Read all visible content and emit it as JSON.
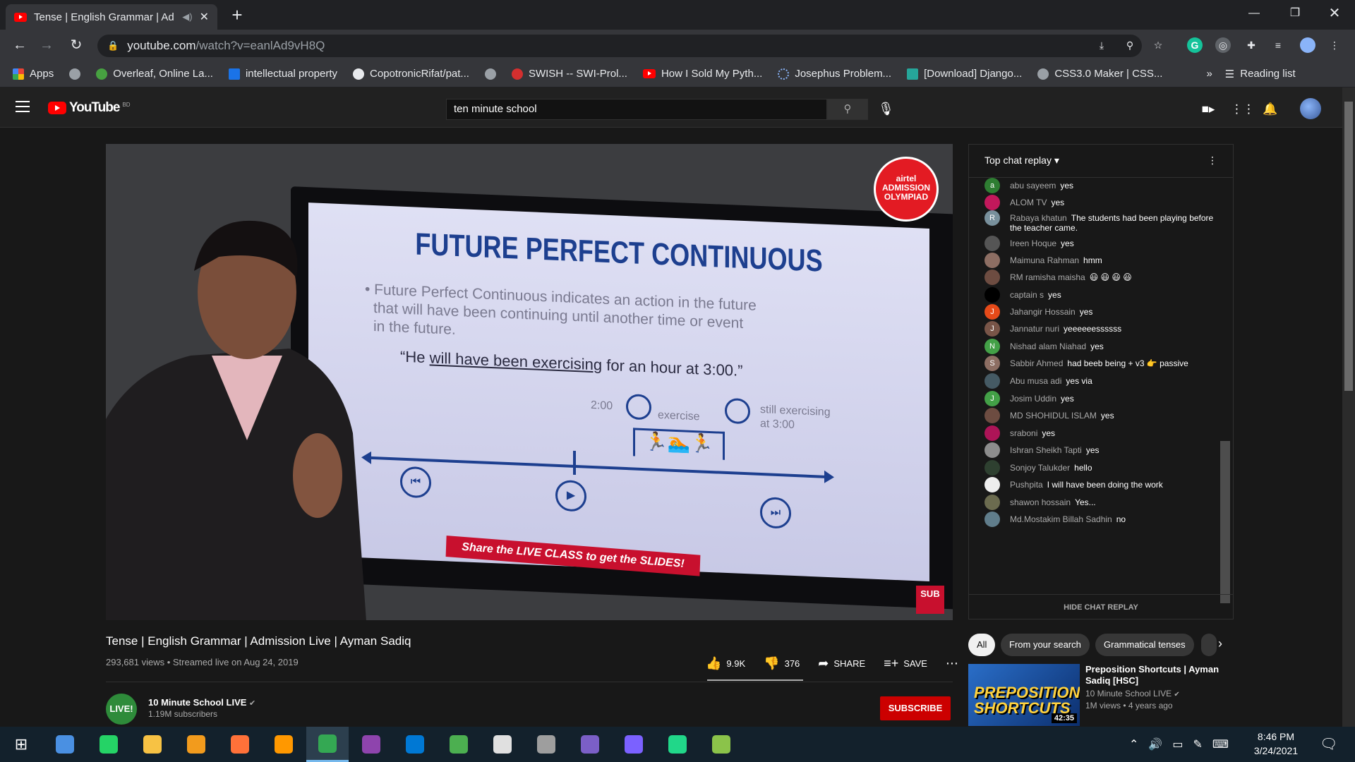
{
  "browser": {
    "tab_title": "Tense | English Grammar | Ad",
    "new_tab": "+",
    "url_host": "youtube.com",
    "url_path": "/watch?v=eanlAd9vH8Q",
    "bookmarks": [
      "Apps",
      "",
      "Overleaf, Online La...",
      "intellectual property",
      "CopotronicRifat/pat...",
      "",
      "SWISH -- SWI-Prol...",
      "How I Sold My Pyth...",
      "Josephus Problem...",
      "[Download] Django...",
      "CSS3.0 Maker | CSS..."
    ],
    "bookmarks_more": "»",
    "reading_list": "Reading list"
  },
  "youtube": {
    "logo_text": "YouTube",
    "country": "BD",
    "search_value": "ten minute school"
  },
  "video": {
    "slide_title": "FUTURE PERFECT CONTINUOUS",
    "slide_line1": "• Future Perfect Continuous indicates an action in the future",
    "slide_line2": "that will have been continuing until another time or event",
    "slide_line3": "in the future.",
    "slide_example_pre": "“He ",
    "slide_example_u": "will have been exercising",
    "slide_example_post": " for an hour at 3:00.”",
    "tl_time": "2:00",
    "tl_exercise": "exercise",
    "tl_still": "still exercising",
    "tl_still2": "at 3:00",
    "share_banner": "Share the LIVE CLASS to get the SLIDES!",
    "olympiad_brand": "airtel",
    "olympiad_line1": "ADMISSION",
    "olympiad_line2": "OLYMPIAD",
    "sub_mark": "SUB"
  },
  "info": {
    "title": "Tense | English Grammar | Admission Live | Ayman Sadiq",
    "meta": "293,681 views • Streamed live on Aug 24, 2019",
    "likes": "9.9K",
    "dislikes": "376",
    "share": "SHARE",
    "save": "SAVE",
    "channel": "10 Minute School LIVE",
    "subs": "1.19M subscribers",
    "subscribe": "SUBSCRIBE",
    "chan_avatar_text": "LIVE!"
  },
  "chat": {
    "header": "Top chat replay",
    "hide": "HIDE CHAT REPLAY",
    "messages": [
      {
        "name": "abu sayeem",
        "text": "yes",
        "initial": "a",
        "color": "#2e7d32"
      },
      {
        "name": "ALOM TV",
        "text": "yes",
        "initial": "",
        "color": "#c2185b"
      },
      {
        "name": "Rabaya khatun",
        "text": "The students had been playing before the teacher came.",
        "initial": "R",
        "color": "#78909c"
      },
      {
        "name": "Ireen Hoque",
        "text": "yes",
        "initial": "",
        "color": "#555555"
      },
      {
        "name": "Maimuna Rahman",
        "text": "hmm",
        "initial": "",
        "color": "#8d6e63"
      },
      {
        "name": "RM ramisha maisha",
        "text": "😃 😃 😃 😃",
        "initial": "",
        "color": "#6d4c41"
      },
      {
        "name": "captain s",
        "text": "yes",
        "initial": "",
        "color": "#000000"
      },
      {
        "name": "Jahangir Hossain",
        "text": "yes",
        "initial": "J",
        "color": "#e64a19"
      },
      {
        "name": "Jannatur nuri",
        "text": "yeeeeeessssss",
        "initial": "J",
        "color": "#795548"
      },
      {
        "name": "Nishad alam Niahad",
        "text": "yes",
        "initial": "N",
        "color": "#43a047"
      },
      {
        "name": "Sabbir Ahmed",
        "text": "had beeb being + v3 👉 passive",
        "initial": "S",
        "color": "#8d6e63"
      },
      {
        "name": "Abu musa adi",
        "text": "yes via",
        "initial": "",
        "color": "#455a64"
      },
      {
        "name": "Josim Uddin",
        "text": "yes",
        "initial": "J",
        "color": "#43a047"
      },
      {
        "name": "MD SHOHIDUL ISLAM",
        "text": "yes",
        "initial": "",
        "color": "#6d4c41"
      },
      {
        "name": "sraboni",
        "text": "yes",
        "initial": "",
        "color": "#ad1457"
      },
      {
        "name": "Ishran Sheikh Tapti",
        "text": "yes",
        "initial": "",
        "color": "#8d8d8d"
      },
      {
        "name": "Sonjoy Talukder",
        "text": "hello",
        "initial": "",
        "color": "#2e4030"
      },
      {
        "name": "Pushpita",
        "text": "I will have been doing the work",
        "initial": "",
        "color": "#eeeeee"
      },
      {
        "name": "shawon hossain",
        "text": "Yes...",
        "initial": "",
        "color": "#6b6b4f"
      },
      {
        "name": "Md.Mostakim Billah Sadhin",
        "text": "no",
        "initial": "",
        "color": "#607d8b"
      }
    ]
  },
  "chips": [
    "All",
    "From your search",
    "Grammatical tenses"
  ],
  "recommendation": {
    "thumb_text": "PREPOSITION SHORTCUTS",
    "duration": "42:35",
    "title": "Preposition Shortcuts | Ayman Sadiq [HSC]",
    "channel": "10 Minute School LIVE",
    "meta": "1M views • 4 years ago"
  },
  "taskbar": {
    "time": "8:46 PM",
    "date": "3/24/2021",
    "apps": [
      {
        "name": "search",
        "color": "#4a90e2"
      },
      {
        "name": "whatsapp",
        "color": "#25d366"
      },
      {
        "name": "file-explorer",
        "color": "#f7c244"
      },
      {
        "name": "app-orange",
        "color": "#f29b1d"
      },
      {
        "name": "firefox",
        "color": "#ff7139"
      },
      {
        "name": "app-sublime",
        "color": "#ff9800"
      },
      {
        "name": "chrome",
        "color": "#34a853"
      },
      {
        "name": "github-desktop",
        "color": "#8e44ad"
      },
      {
        "name": "vscode",
        "color": "#0078d4"
      },
      {
        "name": "app-globe",
        "color": "#4caf50"
      },
      {
        "name": "app-umbrella",
        "color": "#e0e0e0"
      },
      {
        "name": "app-satellite",
        "color": "#9e9e9e"
      },
      {
        "name": "visual-studio",
        "color": "#7b5fc7"
      },
      {
        "name": "messenger",
        "color": "#7b61ff"
      },
      {
        "name": "pycharm",
        "color": "#21d789"
      },
      {
        "name": "app-notepad",
        "color": "#8bc34a"
      }
    ]
  }
}
